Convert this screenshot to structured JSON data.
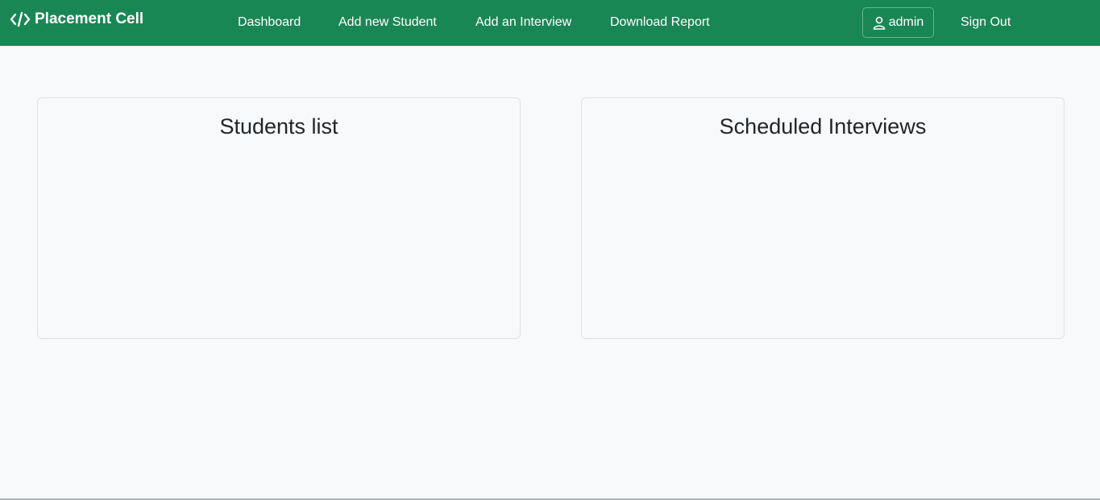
{
  "navbar": {
    "brand": "Placement Cell",
    "brand_icon": "code-icon",
    "background": "#198754",
    "links": [
      {
        "label": "Dashboard"
      },
      {
        "label": "Add new Student"
      },
      {
        "label": "Add an Interview"
      },
      {
        "label": "Download Report"
      }
    ],
    "user": {
      "label": "admin",
      "icon": "user-icon"
    },
    "signout": "Sign Out"
  },
  "main": {
    "cards": [
      {
        "title": "Students list"
      },
      {
        "title": "Scheduled Interviews"
      }
    ]
  }
}
